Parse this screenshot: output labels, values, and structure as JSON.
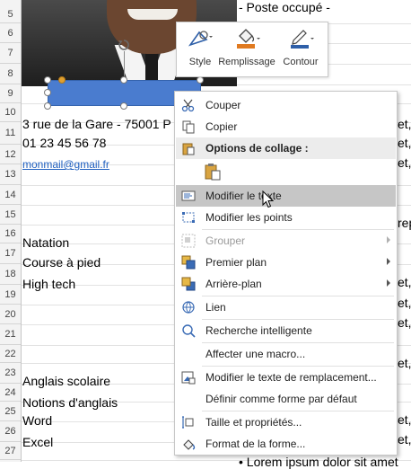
{
  "rows": [
    "5",
    "6",
    "7",
    "8",
    "9",
    "10",
    "11",
    "12",
    "13",
    "14",
    "15",
    "16",
    "17",
    "18",
    "19",
    "20",
    "21",
    "22",
    "23",
    "24",
    "25",
    "26",
    "27"
  ],
  "cells": {
    "poste": "- Poste occupé -",
    "address": "3 rue de la Gare - 75001 P",
    "phone": "01 23 45 56 78",
    "email": "monmail@gmail.fr",
    "hobby1": "Natation",
    "hobby2": "Course à pied",
    "hobby3": "High tech",
    "lang1": "Anglais scolaire",
    "lang2": "Notions d'anglais",
    "soft1": "Word",
    "soft2": "Excel",
    "right_rep": "rep",
    "right_et": "et,",
    "bottom_lorem": "• Lorem ipsum dolor sit amet"
  },
  "mini_toolbar": {
    "style_label": "Style",
    "fill_label": "Remplissage",
    "outline_label": "Contour",
    "colors": {
      "style_shape": "#2e5fa8",
      "fill_bucket": "#e07a20",
      "outline_pen": "#2e5fa8"
    }
  },
  "context_menu": {
    "cut": "Couper",
    "copy": "Copier",
    "paste_options": "Options de collage :",
    "edit_text": "Modifier le texte",
    "edit_points": "Modifier les points",
    "group": "Grouper",
    "bring_front": "Premier plan",
    "send_back": "Arrière-plan",
    "link": "Lien",
    "smart_lookup": "Recherche intelligente",
    "assign_macro": "Affecter une macro...",
    "edit_alt_text": "Modifier le texte de remplacement...",
    "set_default": "Définir comme forme par défaut",
    "size_props": "Taille et propriétés...",
    "format_shape": "Format de la forme..."
  },
  "shape_color": "#4a7ccf"
}
